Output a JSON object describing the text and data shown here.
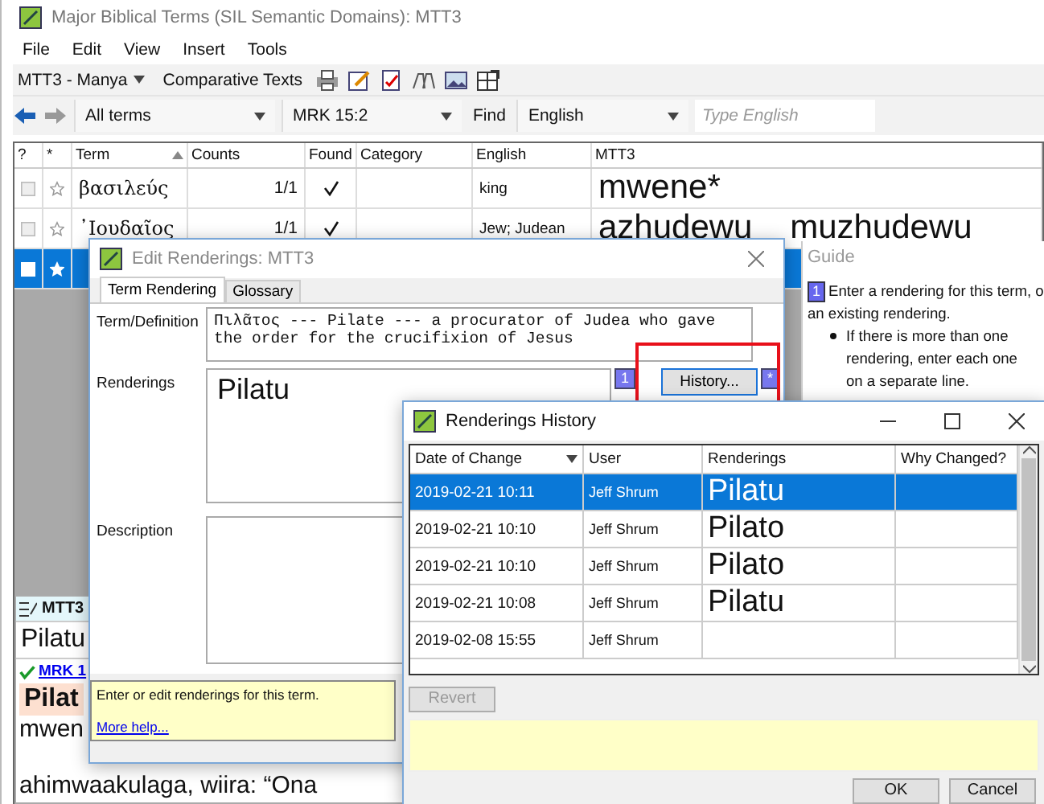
{
  "window": {
    "title": "Major Biblical Terms (SIL Semantic Domains): MTT3"
  },
  "menu": [
    "File",
    "Edit",
    "View",
    "Insert",
    "Tools"
  ],
  "toolbar": {
    "project": "MTT3 - Manya",
    "comparative": "Comparative Texts"
  },
  "nav": {
    "filter": "All terms",
    "reference": "MRK 15:2",
    "find_label": "Find",
    "find_language": "English",
    "search": {
      "placeholder": "Type English"
    }
  },
  "table": {
    "columns": [
      "?",
      "*",
      "Term",
      "Counts",
      "Found",
      "Category",
      "English",
      "MTT3"
    ],
    "rows": [
      {
        "term": "βασιλεύς",
        "counts": "1/1",
        "found": true,
        "english": "king",
        "rendering": "mwene*",
        "selected": false
      },
      {
        "term": "᾿Ιουδαῖος",
        "counts": "1/1",
        "found": true,
        "english": "Jew; Judean",
        "rendering": "azhudewu    muzhudewu",
        "selected": false
      },
      {
        "selected": true
      }
    ]
  },
  "guide": {
    "title": "Guide",
    "badge": "1",
    "intro": [
      "Enter a rendering for this term, o",
      "an existing rendering."
    ],
    "bullets": [
      "If there is more than one rendering, enter each one on a separate line."
    ]
  },
  "bottom_panel": {
    "title": "MTT3",
    "rendering": "Pilatu",
    "reference": "MRK 1",
    "verse_word": "Pilat",
    "lines": [
      "mwen",
      "ahimwaakulaga, wiira: “Ona"
    ]
  },
  "edit_dialog": {
    "title": "Edit Renderings: MTT3",
    "tabs": [
      {
        "label": "Term Rendering",
        "selected": true
      },
      {
        "label": "Glossary",
        "selected": false
      }
    ],
    "term_label": "Term/Definition",
    "term_text": "Πιλᾶτος --- Pilate --- a procurator of Judea who gave\nthe order for the crucifixion of Jesus",
    "renderings_label": "Renderings",
    "renderings": "Pilatu",
    "badge": "1",
    "history_button": "History...",
    "history_badge": "*",
    "description_label": "Description",
    "help": {
      "text": "Enter or edit renderings for this term.",
      "link": "More help..."
    }
  },
  "history_dialog": {
    "title": "Renderings History",
    "columns": [
      "Date of Change",
      "User",
      "Renderings",
      "Why Changed?"
    ],
    "rows": [
      {
        "date": "2019-02-21 10:11",
        "user": "Jeff Shrum",
        "rendering": "Pilatu",
        "selected": true
      },
      {
        "date": "2019-02-21 10:10",
        "user": "Jeff Shrum",
        "rendering": "Pilato",
        "selected": false
      },
      {
        "date": "2019-02-21 10:10",
        "user": "Jeff Shrum",
        "rendering": "Pilato",
        "selected": false
      },
      {
        "date": "2019-02-21 10:08",
        "user": "Jeff Shrum",
        "rendering": "Pilatu",
        "selected": false
      },
      {
        "date": "2019-02-08 15:55",
        "user": "Jeff Shrum",
        "selected": false
      }
    ],
    "revert": {
      "label": "Revert",
      "disabled": true
    },
    "buttons": [
      "OK",
      "Cancel"
    ]
  }
}
